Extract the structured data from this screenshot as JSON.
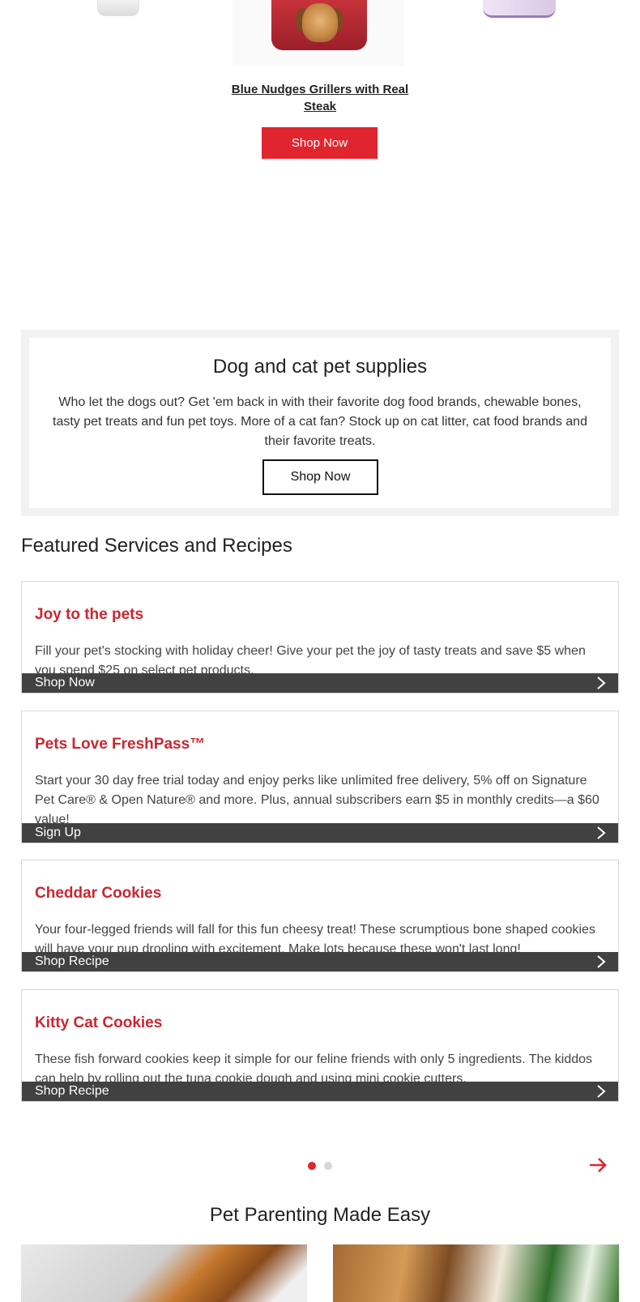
{
  "top_carousel": {
    "product_title": "Blue Nudges Grillers with Real Steak",
    "cta_label": "Shop Now"
  },
  "supplies": {
    "title": "Dog and cat pet supplies",
    "text": "Who let the dogs out? Get 'em back in with their favorite dog food brands, chewable bones, tasty pet treats and fun pet toys. More of a cat fan? Stock up on cat litter, cat food brands and their favorite treats.",
    "cta_label": "Shop Now"
  },
  "featured": {
    "heading": "Featured Services and Recipes",
    "cards": [
      {
        "title": "Joy to the pets",
        "text": "Fill your pet's stocking with holiday cheer! Give your pet the joy of tasty treats and save $5 when you spend $25 on select pet products.",
        "cta_label": "Shop Now"
      },
      {
        "title": "Pets Love FreshPass™",
        "text": "Start your 30 day free trial today and enjoy perks like unlimited free delivery, 5% off on Signature Pet Care® & Open Nature® and more. Plus, annual subscribers earn $5 in monthly credits—a $60 value!",
        "cta_label": "Sign Up"
      },
      {
        "title": "Cheddar Cookies",
        "text": "Your four-legged friends will fall for this fun cheesy treat! These scrumptious bone shaped cookies will have your pup drooling with excitement. Make lots because these won't last long!",
        "cta_label": "Shop Recipe"
      },
      {
        "title": "Kitty Cat Cookies",
        "text": "These fish forward cookies keep it simple for our feline friends with only 5 ingredients. The kiddos can help by rolling out the tuna cookie dough and using mini cookie cutters.",
        "cta_label": "Shop Recipe"
      }
    ],
    "pagination": {
      "active_page": 1,
      "total_pages": 2
    }
  },
  "parenting": {
    "heading": "Pet Parenting Made Easy"
  },
  "colors": {
    "accent_red": "#e1252f",
    "title_red": "#cc2630",
    "bar_dark": "#414141",
    "dot_inactive": "#d6d6d6"
  },
  "icons": [
    "chevron-right-icon",
    "arrow-right-icon"
  ]
}
